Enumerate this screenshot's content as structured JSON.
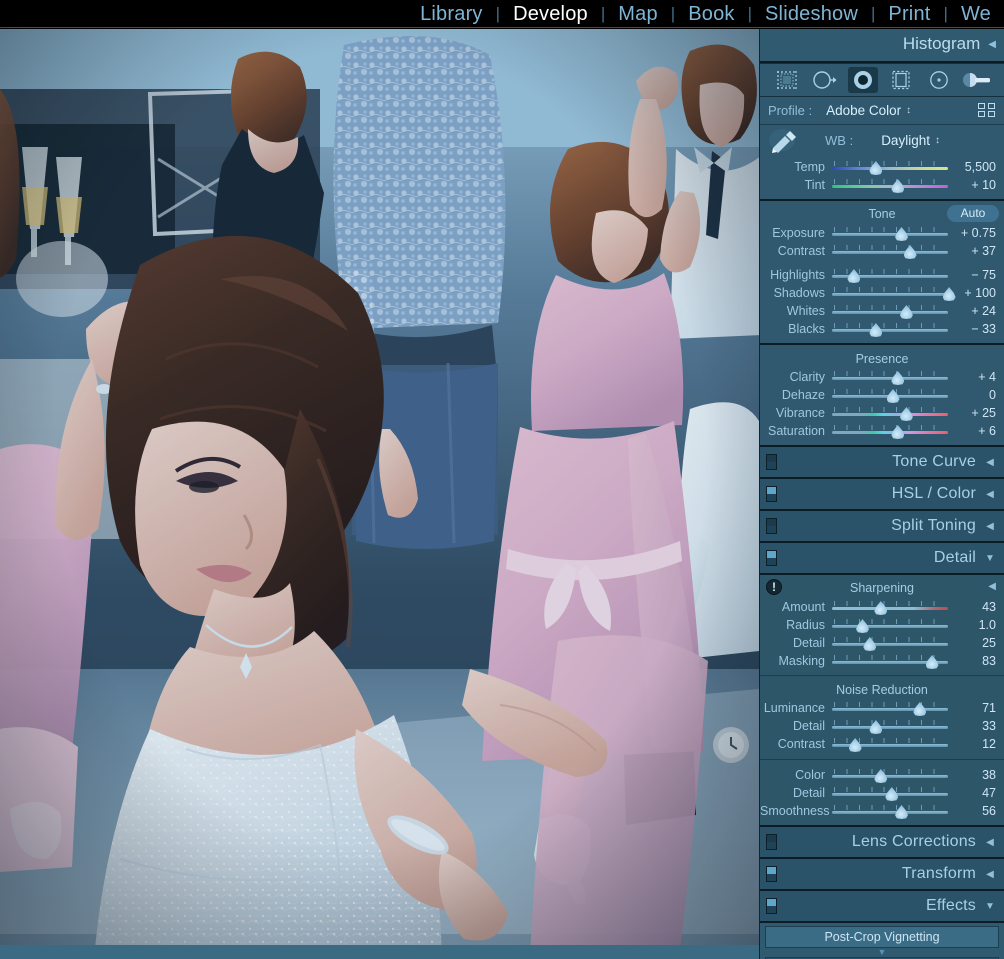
{
  "module_bar": {
    "items": [
      {
        "label": "Library",
        "active": false
      },
      {
        "label": "Develop",
        "active": true
      },
      {
        "label": "Map",
        "active": false
      },
      {
        "label": "Book",
        "active": false
      },
      {
        "label": "Slideshow",
        "active": false
      },
      {
        "label": "Print",
        "active": false
      },
      {
        "label": "We",
        "active": false
      }
    ],
    "separator": "|"
  },
  "photo": {
    "description": "Wedding reception dance floor photograph: bride in white beaded gown in foreground, guests dancing, pink bridesmaid dresses, blue-toned indoor lighting"
  },
  "right_panel": {
    "histogram": {
      "title": "Histogram",
      "arrow": "◀"
    },
    "tools": [
      {
        "name": "crop-overlay-tool",
        "selected": false
      },
      {
        "name": "spot-removal-tool",
        "selected": false
      },
      {
        "name": "red-eye-correction-tool",
        "selected": true
      },
      {
        "name": "graduated-filter-tool",
        "selected": false
      },
      {
        "name": "radial-filter-tool",
        "selected": false
      },
      {
        "name": "adjustment-brush-tool",
        "selected": false
      }
    ],
    "profile": {
      "label": "Profile :",
      "value": "Adobe Color",
      "stepper": "↕",
      "browser_icon": "profile-grid-icon"
    },
    "basic": {
      "white_balance": {
        "label": "WB :",
        "value": "Daylight",
        "stepper": "↕",
        "eyedropper_icon": "white-balance-eyedropper-icon",
        "sliders": [
          {
            "label": "Temp",
            "value": "5,500",
            "pos": 36,
            "track": "temp"
          },
          {
            "label": "Tint",
            "value": "+ 10",
            "pos": 54,
            "track": "tint"
          }
        ]
      },
      "tone": {
        "title": "Tone",
        "auto_label": "Auto",
        "sliders": [
          {
            "label": "Exposure",
            "value": "+ 0.75",
            "pos": 57,
            "track": "plain"
          },
          {
            "label": "Contrast",
            "value": "+ 37",
            "pos": 64,
            "track": "plain"
          },
          {
            "label": "Highlights",
            "value": "− 75",
            "pos": 18,
            "track": "plain"
          },
          {
            "label": "Shadows",
            "value": "+ 100",
            "pos": 96,
            "track": "plain"
          },
          {
            "label": "Whites",
            "value": "+ 24",
            "pos": 61,
            "track": "plain"
          },
          {
            "label": "Blacks",
            "value": "− 33",
            "pos": 36,
            "track": "plain"
          }
        ]
      },
      "presence": {
        "title": "Presence",
        "sliders": [
          {
            "label": "Clarity",
            "value": "+ 4",
            "pos": 54,
            "track": "plain"
          },
          {
            "label": "Dehaze",
            "value": "0",
            "pos": 50,
            "track": "plain"
          },
          {
            "label": "Vibrance",
            "value": "+ 25",
            "pos": 61,
            "track": "vibrance"
          },
          {
            "label": "Saturation",
            "value": "+ 6",
            "pos": 54,
            "track": "vibrance"
          }
        ]
      }
    },
    "collapsed_panels_upper": [
      {
        "title": "Tone Curve",
        "arrow": "◀",
        "switch_on": false
      },
      {
        "title": "HSL / Color",
        "arrow": "◀",
        "switch_on": true
      },
      {
        "title": "Split Toning",
        "arrow": "◀",
        "switch_on": false
      }
    ],
    "detail": {
      "title": "Detail",
      "arrow": "▼",
      "switch_on": true,
      "sharpening": {
        "title": "Sharpening",
        "arrow": "◀",
        "warning_icon": "!",
        "sliders": [
          {
            "label": "Amount",
            "value": "43",
            "pos": 40,
            "track": "sharp"
          },
          {
            "label": "Radius",
            "value": "1.0",
            "pos": 25,
            "track": "plain"
          },
          {
            "label": "Detail",
            "value": "25",
            "pos": 31,
            "track": "plain"
          },
          {
            "label": "Masking",
            "value": "83",
            "pos": 82,
            "track": "plain"
          }
        ]
      },
      "noise_reduction": {
        "title": "Noise Reduction",
        "luminance_group": [
          {
            "label": "Luminance",
            "value": "71",
            "pos": 72,
            "track": "plain"
          },
          {
            "label": "Detail",
            "value": "33",
            "pos": 36,
            "track": "plain"
          },
          {
            "label": "Contrast",
            "value": "12",
            "pos": 19,
            "track": "plain"
          }
        ],
        "color_group": [
          {
            "label": "Color",
            "value": "38",
            "pos": 40,
            "track": "plain"
          },
          {
            "label": "Detail",
            "value": "47",
            "pos": 49,
            "track": "plain"
          },
          {
            "label": "Smoothness",
            "value": "56",
            "pos": 57,
            "track": "plain"
          }
        ]
      }
    },
    "collapsed_panels_lower": [
      {
        "title": "Lens Corrections",
        "arrow": "◀",
        "switch_on": false
      },
      {
        "title": "Transform",
        "arrow": "◀",
        "switch_on": true
      }
    ],
    "effects": {
      "title": "Effects",
      "arrow": "▼",
      "switch_on": true,
      "post_crop_vignetting": "Post-Crop Vignetting",
      "caret": "▼"
    }
  },
  "colors": {
    "panel_bg": "#30596f",
    "panel_head_bg": "#2a5269",
    "top_bar_bg": "#000000",
    "module_text": "#7fb4d4",
    "module_active_text": "#ffffff",
    "label_text": "#9ec8e0",
    "value_text": "#cfe6f5",
    "separator": "#0d1c25"
  }
}
